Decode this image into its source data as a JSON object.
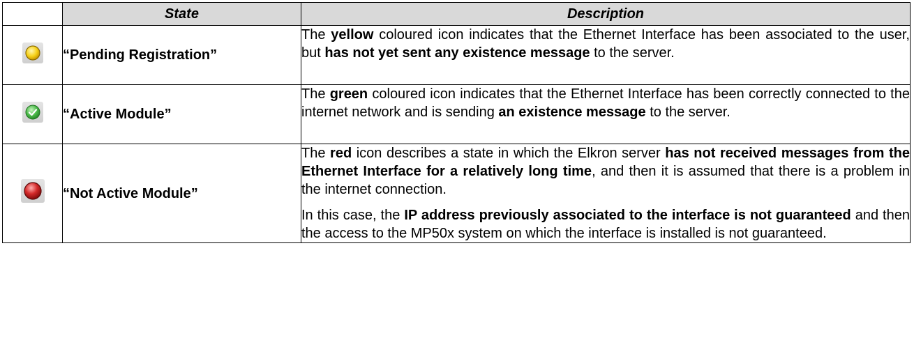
{
  "header": {
    "state": "State",
    "description": "Description"
  },
  "rows": [
    {
      "icon": "yellow-circle-icon",
      "color": "#f2c400",
      "state": "“Pending Registration”",
      "desc": {
        "s1": "The ",
        "b1": "yellow",
        "s2": " coloured icon indicates that the Ethernet Interface has been associated to the user, but ",
        "b2": "has not yet sent any existence message",
        "s3": " to the server."
      }
    },
    {
      "icon": "green-check-icon",
      "color": "#3fae3f",
      "state": "“Active Module”",
      "desc": {
        "s1": "The ",
        "b1": "green",
        "s2": " coloured icon indicates that the Ethernet Interface has been correctly connected to the internet network and is sending ",
        "b2": "an existence message",
        "s3": " to the server."
      }
    },
    {
      "icon": "red-circle-icon",
      "color": "#c81e1e",
      "state": "“Not Active Module”",
      "desc": {
        "s1": "The ",
        "b1": "red",
        "s2": " icon describes a state in which the Elkron server ",
        "b2": "has not received messages from the Ethernet Interface for a relatively long time",
        "s3": ", and then it is assumed that there is a problem in the internet connection."
      },
      "desc2": {
        "s1": "In this case, the ",
        "b1": "IP address previously associated to the interface is not guaranteed",
        "s2": " and then the access to the MP50x system on which the interface is installed is not guaranteed."
      }
    }
  ]
}
